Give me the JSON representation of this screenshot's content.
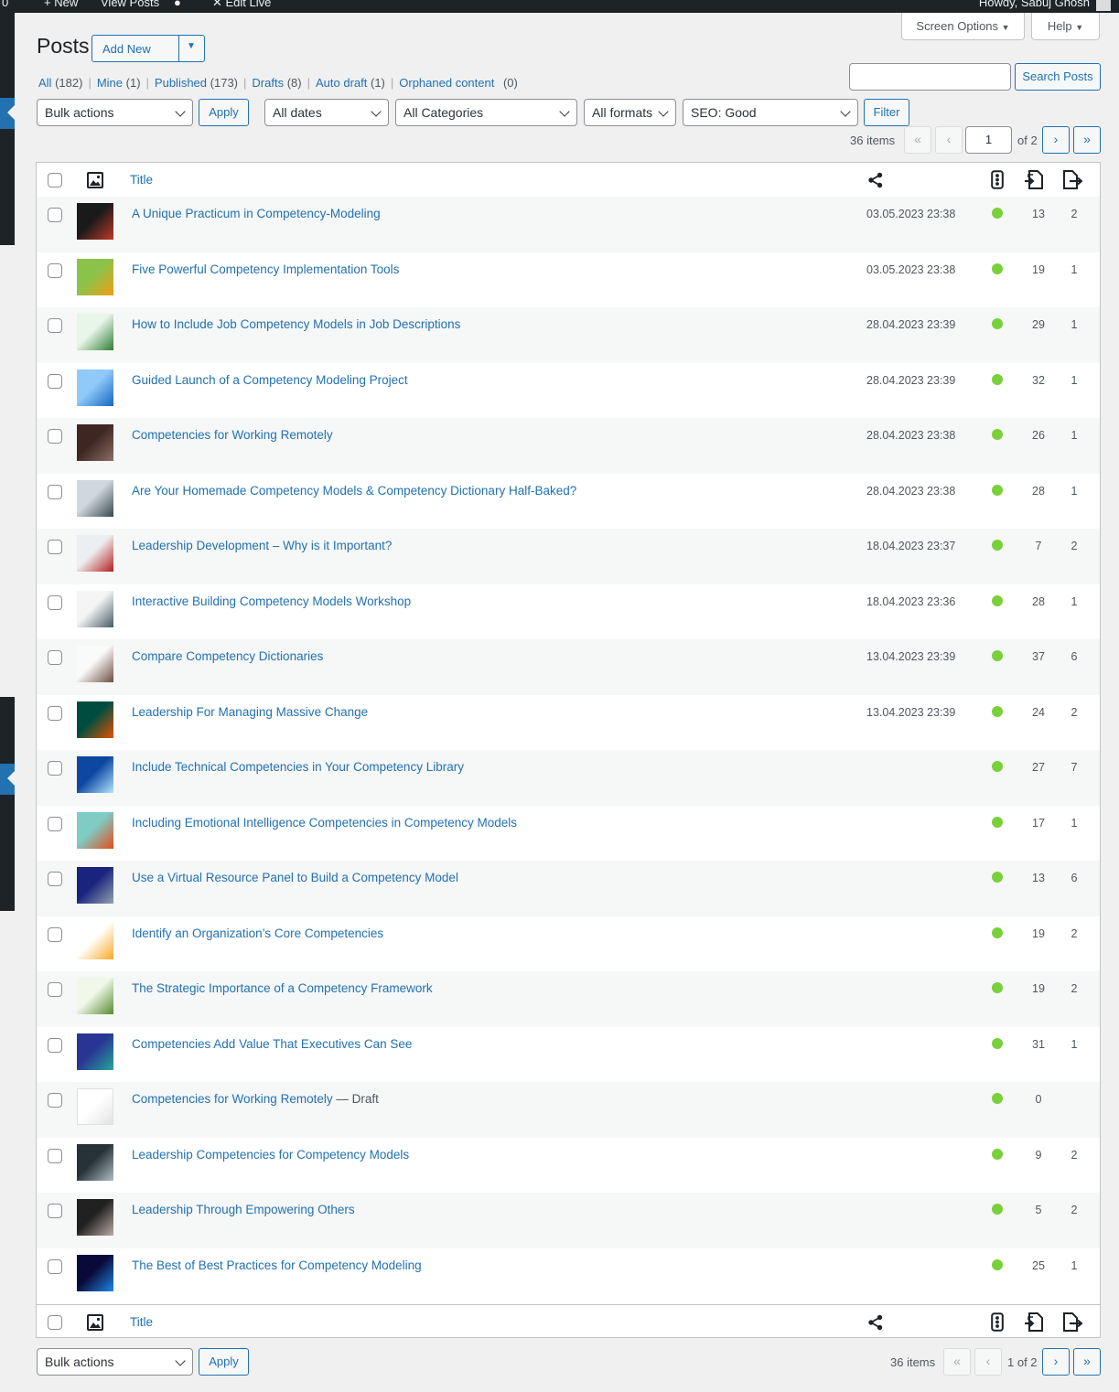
{
  "adminbar": {
    "items": [
      "0",
      "New",
      "View Posts",
      "Edit Live"
    ],
    "greeting": "Howdy, Sabuj Ghosh"
  },
  "screen_options": {
    "label": "Screen Options",
    "arrow": "▼"
  },
  "help": {
    "label": "Help",
    "arrow": "▼"
  },
  "page_title": "Posts",
  "add_new": {
    "label": "Add New",
    "arrow": "▼"
  },
  "views": [
    {
      "label": "All",
      "count": "(182)"
    },
    {
      "label": "Mine",
      "count": "(1)"
    },
    {
      "label": "Published",
      "count": "(173)"
    },
    {
      "label": "Drafts",
      "count": "(8)"
    },
    {
      "label": "Auto draft",
      "count": "(1)"
    },
    {
      "label": "Orphaned content",
      "count": "(0)"
    }
  ],
  "view_separator": "|",
  "search": {
    "value": "",
    "button": "Search Posts"
  },
  "filters": {
    "bulk_actions": "Bulk actions",
    "apply": "Apply",
    "dates": "All dates",
    "categories": "All Categories",
    "formats": "All formats",
    "seo": "SEO: Good",
    "filter_button": "Filter"
  },
  "pagination": {
    "items": "36 items",
    "first": "«",
    "prev": "‹",
    "next": "›",
    "last": "»",
    "current_page": "1",
    "of_label": "of 2",
    "bottom_current": "1 of 2"
  },
  "columns": {
    "title": "Title"
  },
  "icons": {
    "thumbnail_col": "image-icon",
    "share_col": "share-icon",
    "traffic_col": "traffic-light-icon",
    "links_in_col": "internal-links-icon",
    "links_out_col": "incoming-links-icon"
  },
  "colors": {
    "seo_good": "#7ad03a",
    "link": "#2271b1",
    "admin_bar": "#1d2327",
    "accent_blue": "#2271b1"
  },
  "posts": [
    {
      "title": "A Unique Practicum in Competency-Modeling",
      "state": "",
      "date": "03.05.2023 23:38",
      "links": "13",
      "linked": "2",
      "thumb": [
        "#1a1a1a",
        "#c0392b"
      ]
    },
    {
      "title": "Five Powerful Competency Implementation Tools",
      "state": "",
      "date": "03.05.2023 23:38",
      "links": "19",
      "linked": "1",
      "thumb": [
        "#8bc34a",
        "#f39c12"
      ]
    },
    {
      "title": "How to Include Job Competency Models in Job Descriptions",
      "state": "",
      "date": "28.04.2023 23:39",
      "links": "29",
      "linked": "1",
      "thumb": [
        "#e8f5e9",
        "#2e7d32"
      ]
    },
    {
      "title": "Guided Launch of a Competency Modeling Project",
      "state": "",
      "date": "28.04.2023 23:39",
      "links": "32",
      "linked": "1",
      "thumb": [
        "#90caf9",
        "#1565c0"
      ]
    },
    {
      "title": "Competencies for Working Remotely",
      "state": "",
      "date": "28.04.2023 23:38",
      "links": "26",
      "linked": "1",
      "thumb": [
        "#3e2723",
        "#8d6e63"
      ]
    },
    {
      "title": "Are Your Homemade Competency Models & Competency Dictionary Half-Baked?",
      "state": "",
      "date": "28.04.2023 23:38",
      "links": "28",
      "linked": "1",
      "thumb": [
        "#cfd8dc",
        "#37474f"
      ]
    },
    {
      "title": "Leadership Development – Why is it Important?",
      "state": "",
      "date": "18.04.2023 23:37",
      "links": "7",
      "linked": "2",
      "thumb": [
        "#eceff1",
        "#b71c1c"
      ]
    },
    {
      "title": "Interactive Building Competency Models Workshop",
      "state": "",
      "date": "18.04.2023 23:36",
      "links": "28",
      "linked": "1",
      "thumb": [
        "#f5f5f5",
        "#455a64"
      ]
    },
    {
      "title": "Compare Competency Dictionaries",
      "state": "",
      "date": "13.04.2023 23:39",
      "links": "37",
      "linked": "6",
      "thumb": [
        "#fafafa",
        "#6d4c41"
      ]
    },
    {
      "title": "Leadership For Managing Massive Change",
      "state": "",
      "date": "13.04.2023 23:39",
      "links": "24",
      "linked": "2",
      "thumb": [
        "#004d40",
        "#e65100"
      ]
    },
    {
      "title": "Include Technical Competencies in Your Competency Library",
      "state": "",
      "date": "",
      "links": "27",
      "linked": "7",
      "thumb": [
        "#0d47a1",
        "#b3e5fc"
      ]
    },
    {
      "title": "Including Emotional Intelligence Competencies in Competency Models",
      "state": "",
      "date": "",
      "links": "17",
      "linked": "1",
      "thumb": [
        "#80cbc4",
        "#e64a19"
      ]
    },
    {
      "title": "Use a Virtual Resource Panel to Build a Competency Model",
      "state": "",
      "date": "",
      "links": "13",
      "linked": "6",
      "thumb": [
        "#1a237e",
        "#90a4ae"
      ]
    },
    {
      "title": "Identify an Organization’s Core Competencies",
      "state": "",
      "date": "",
      "links": "19",
      "linked": "2",
      "thumb": [
        "#ffffff",
        "#f9a825"
      ]
    },
    {
      "title": "The Strategic Importance of a Competency Framework",
      "state": "",
      "date": "",
      "links": "19",
      "linked": "2",
      "thumb": [
        "#f1f8e9",
        "#558b2f"
      ]
    },
    {
      "title": "Competencies Add Value That Executives Can See",
      "state": "",
      "date": "",
      "links": "31",
      "linked": "1",
      "thumb": [
        "#283593",
        "#26a69a"
      ]
    },
    {
      "title": "Competencies for Working Remotely",
      "state": "— Draft",
      "date": "",
      "links": "0",
      "linked": "",
      "thumb": [
        "#ffffff",
        "#e0e0e0"
      ]
    },
    {
      "title": "Leadership Competencies for Competency Models",
      "state": "",
      "date": "",
      "links": "9",
      "linked": "2",
      "thumb": [
        "#263238",
        "#b0bec5"
      ]
    },
    {
      "title": "Leadership Through Empowering Others",
      "state": "",
      "date": "",
      "links": "5",
      "linked": "2",
      "thumb": [
        "#212121",
        "#bcaaa4"
      ]
    },
    {
      "title": "The Best of Best Practices for Competency Modeling",
      "state": "",
      "date": "",
      "links": "25",
      "linked": "1",
      "thumb": [
        "#0a0a3a",
        "#1e88e5"
      ]
    }
  ]
}
